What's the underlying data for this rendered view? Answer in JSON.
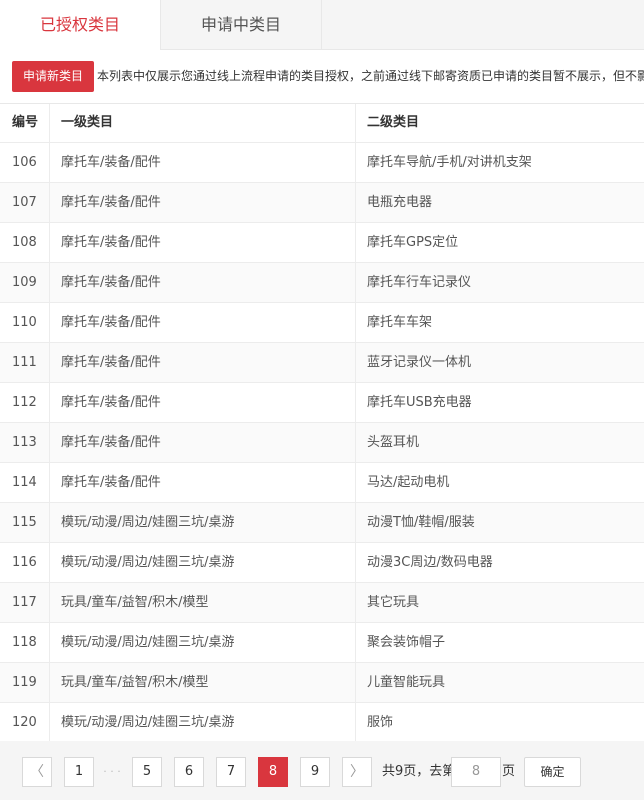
{
  "tabs": {
    "authorized": "已授权类目",
    "pending": "申请中类目"
  },
  "toolbar": {
    "apply_label": "申请新类目",
    "notice": "本列表中仅展示您通过线上流程申请的类目授权，之前通过线下邮寄资质已申请的类目暂不展示，但不影"
  },
  "table": {
    "headers": {
      "id": "编号",
      "level1": "一级类目",
      "level2": "二级类目"
    },
    "rows": [
      {
        "id": "106",
        "level1": "摩托车/装备/配件",
        "level2": "摩托车导航/手机/对讲机支架"
      },
      {
        "id": "107",
        "level1": "摩托车/装备/配件",
        "level2": "电瓶充电器"
      },
      {
        "id": "108",
        "level1": "摩托车/装备/配件",
        "level2": "摩托车GPS定位"
      },
      {
        "id": "109",
        "level1": "摩托车/装备/配件",
        "level2": "摩托车行车记录仪"
      },
      {
        "id": "110",
        "level1": "摩托车/装备/配件",
        "level2": "摩托车车架"
      },
      {
        "id": "111",
        "level1": "摩托车/装备/配件",
        "level2": "蓝牙记录仪一体机"
      },
      {
        "id": "112",
        "level1": "摩托车/装备/配件",
        "level2": "摩托车USB充电器"
      },
      {
        "id": "113",
        "level1": "摩托车/装备/配件",
        "level2": "头盔耳机"
      },
      {
        "id": "114",
        "level1": "摩托车/装备/配件",
        "level2": "马达/起动电机"
      },
      {
        "id": "115",
        "level1": "模玩/动漫/周边/娃圈三坑/桌游",
        "level2": "动漫T恤/鞋帽/服装"
      },
      {
        "id": "116",
        "level1": "模玩/动漫/周边/娃圈三坑/桌游",
        "level2": "动漫3C周边/数码电器"
      },
      {
        "id": "117",
        "level1": "玩具/童车/益智/积木/模型",
        "level2": "其它玩具"
      },
      {
        "id": "118",
        "level1": "模玩/动漫/周边/娃圈三坑/桌游",
        "level2": "聚会装饰帽子"
      },
      {
        "id": "119",
        "level1": "玩具/童车/益智/积木/模型",
        "level2": "儿童智能玩具"
      },
      {
        "id": "120",
        "level1": "模玩/动漫/周边/娃圈三坑/桌游",
        "level2": "服饰"
      }
    ]
  },
  "pagination": {
    "prev_icon": "chevron-left-icon",
    "next_icon": "chevron-right-icon",
    "prev_glyph": "〈",
    "next_glyph": "〉",
    "ellipsis": "· · ·",
    "pages": [
      "1",
      "5",
      "6",
      "7",
      "8",
      "9"
    ],
    "current": "8",
    "total_text": "共9页，去第",
    "goto_value": "8",
    "page_suffix": "页",
    "confirm_label": "确定"
  },
  "colors": {
    "accent": "#d9363e",
    "border": "#e8e8e8",
    "alt_row": "#fafafa"
  }
}
